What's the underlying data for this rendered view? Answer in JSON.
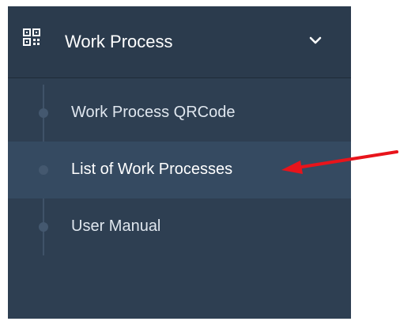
{
  "menu": {
    "title": "Work Process",
    "icon": "qrcode-icon",
    "expanded": true,
    "items": [
      {
        "label": "Work Process QRCode",
        "active": false
      },
      {
        "label": "List of Work Processes",
        "active": true
      },
      {
        "label": "User Manual",
        "active": false
      }
    ]
  },
  "colors": {
    "sidebar_bg": "#2e3f52",
    "header_bg": "#2b3b4d",
    "active_bg": "#354a61",
    "annotation_arrow": "#e8141b"
  }
}
